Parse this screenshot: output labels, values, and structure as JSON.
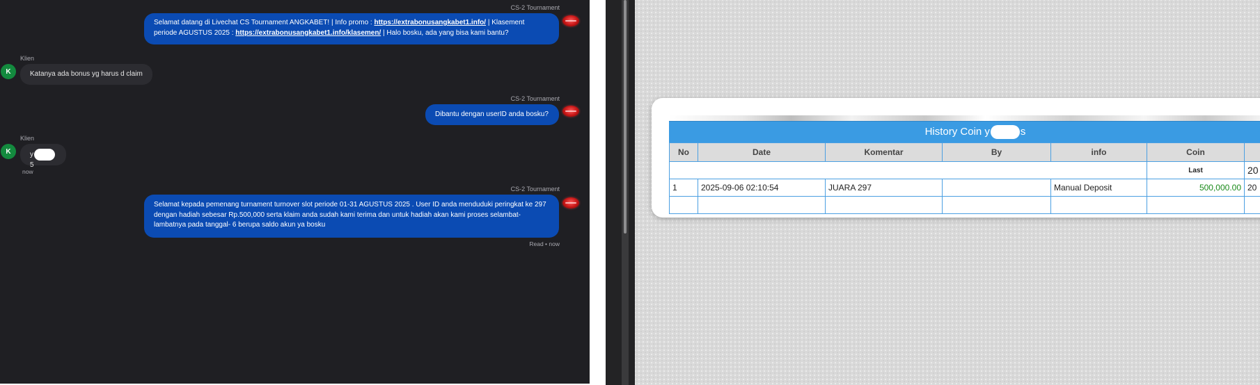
{
  "chat": {
    "messages": [
      {
        "sender": "CS-2 Tournament",
        "parts": {
          "p1": "Selamat datang di Livechat CS Tournament ANGKABET! | Info promo : ",
          "link1": "https://extrabonusangkabet1.info/",
          "p2": " | Klasement periode AGUSTUS 2025 : ",
          "link2": "https://extrabonusangkabet1.info/klasemen/",
          "p3": " | Halo bosku, ada yang bisa kami bantu?"
        }
      },
      {
        "sender": "Klien",
        "avatar": "K",
        "text": "Katanya ada bonus yg harus d claim"
      },
      {
        "sender": "CS-2 Tournament",
        "text": "Dibantu dengan userID anda bosku?"
      },
      {
        "sender": "Klien",
        "avatar": "K",
        "text_prefix": "y",
        "text_suffix": "5",
        "time": "now"
      },
      {
        "sender": "CS-2 Tournament",
        "text": "Selamat kepada pemenang turnament turnover slot periode 01-31 AGUSTUS 2025 . User ID anda menduduki peringkat ke 297 dengan hadiah sebesar Rp.500,000 serta klaim anda sudah kami terima dan untuk hadiah akan kami proses selambat-lambatnya pada tanggal- 6 berupa saldo akun ya bosku",
        "status": "Read • now"
      }
    ]
  },
  "history": {
    "title_prefix": "History Coin y",
    "title_suffix": "s",
    "columns": [
      "No",
      "Date",
      "Komentar",
      "By",
      "info",
      "Coin",
      ""
    ],
    "last_row": {
      "label": "Last",
      "overflow": "20"
    },
    "rows": [
      {
        "no": "1",
        "date": "2025-09-06 02:10:54",
        "komentar": "JUARA 297",
        "by": "",
        "info": "Manual Deposit",
        "coin": "500,000.00",
        "overflow": "20"
      }
    ],
    "colors": {
      "header": "#3a9be3",
      "coin": "#1a8a1a",
      "agent_bubble": "#0b4bb3"
    }
  }
}
